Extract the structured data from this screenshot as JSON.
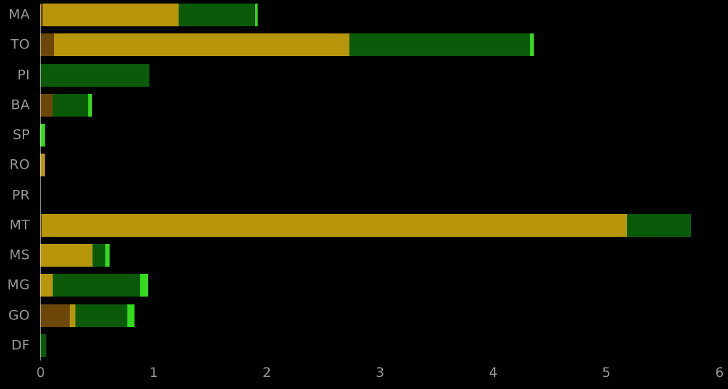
{
  "chart_data": {
    "type": "bar",
    "orientation": "horizontal",
    "stacked": true,
    "title": "",
    "subtitle": "",
    "xlabel": "",
    "ylabel": "",
    "xlim": [
      0,
      6
    ],
    "ylim": null,
    "grid": false,
    "legend": null,
    "background_color": "#000000",
    "text_color": "#999999",
    "axis_color": "#c8c8c8",
    "xticks": [
      0,
      1,
      2,
      3,
      4,
      5,
      6
    ],
    "xtick_labels": [
      "0",
      "1",
      "2",
      "3",
      "4",
      "5",
      "6"
    ],
    "categories": [
      "MA",
      "TO",
      "PI",
      "BA",
      "SP",
      "RO",
      "PR",
      "MT",
      "MS",
      "MG",
      "GO",
      "DF"
    ],
    "series": [
      {
        "name": "series-brown",
        "color": "#6B4709",
        "values": [
          0.02,
          0.12,
          0.0,
          0.11,
          0.0,
          0.0,
          0.0,
          0.01,
          0.0,
          0.0,
          0.26,
          0.0
        ]
      },
      {
        "name": "series-goldenrod",
        "color": "#B8960C",
        "values": [
          1.2,
          2.61,
          0.0,
          0.0,
          0.0,
          0.04,
          0.0,
          5.17,
          0.46,
          0.11,
          0.05,
          0.0
        ]
      },
      {
        "name": "series-dark-green",
        "color": "#0A5A0A",
        "values": [
          0.67,
          1.6,
          0.96,
          0.31,
          0.0,
          0.0,
          0.0,
          0.57,
          0.11,
          0.77,
          0.46,
          0.05
        ]
      },
      {
        "name": "series-bright-green",
        "color": "#33DD19",
        "values": [
          0.03,
          0.03,
          0.0,
          0.03,
          0.04,
          0.0,
          0.0,
          0.0,
          0.04,
          0.07,
          0.06,
          0.0
        ]
      }
    ],
    "totals": [
      1.92,
      4.36,
      0.96,
      0.45,
      0.04,
      0.04,
      0.0,
      5.75,
      0.61,
      0.95,
      0.83,
      0.05
    ]
  }
}
